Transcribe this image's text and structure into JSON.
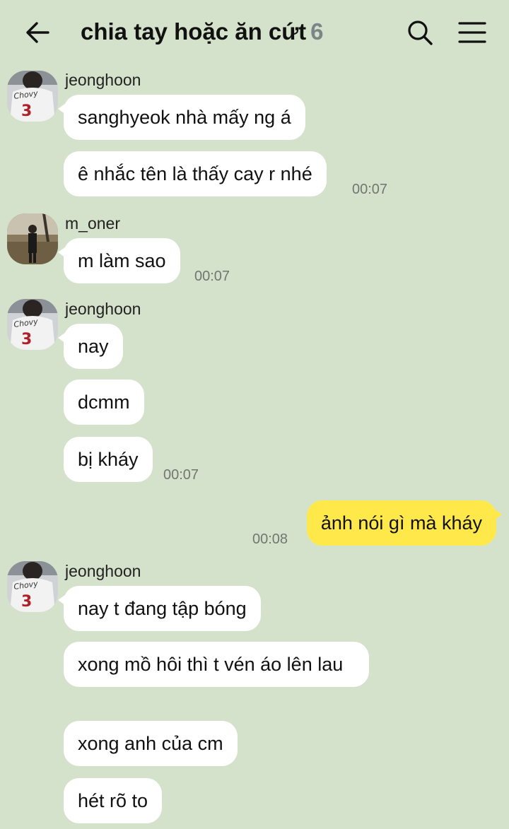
{
  "header": {
    "title": "chia tay hoặc ăn cứt",
    "member_count": "6"
  },
  "messages": [
    {
      "sender": "jeonghoon",
      "bubbles": [
        "sanghyeok nhà mấy ng á",
        "ê nhắc tên là thấy cay r nhé"
      ],
      "time": "00:07"
    },
    {
      "sender": "m_oner",
      "bubbles": [
        "m làm sao"
      ],
      "time": "00:07"
    },
    {
      "sender": "jeonghoon",
      "bubbles": [
        "nay",
        "dcmm",
        "bị kháy"
      ],
      "time": "00:07"
    },
    {
      "mine": "ảnh nói gì mà kháy",
      "time": "00:08"
    },
    {
      "sender": "jeonghoon",
      "bubbles": [
        "nay t đang tập bóng",
        "xong mồ hôi thì t vén áo lên lau",
        "xong anh của cm",
        "hét rõ to"
      ]
    }
  ],
  "avatar_jersey_text": "Chovy",
  "avatar_jersey_number": "3",
  "colors": {
    "background": "#d5e2cb",
    "own_bubble": "#ffe94a",
    "other_bubble": "#ffffff"
  }
}
